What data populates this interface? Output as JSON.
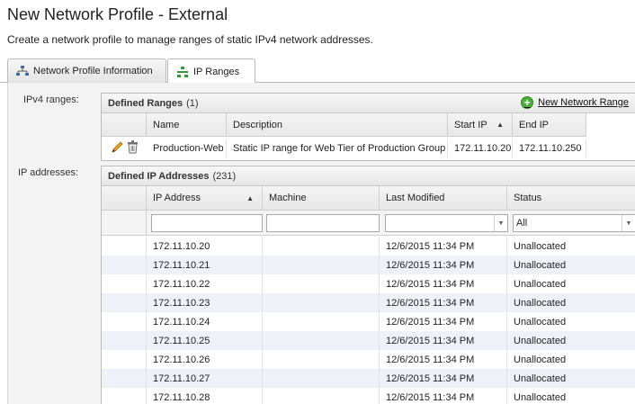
{
  "page": {
    "title": "New Network Profile - External",
    "subtitle": "Create a network profile to manage ranges of static IPv4 network addresses."
  },
  "tabs": [
    {
      "label": "Network Profile Information",
      "icon": "network-icon",
      "active": false
    },
    {
      "label": "IP Ranges",
      "icon": "ip-ranges-icon",
      "active": true
    }
  ],
  "ipv4": {
    "label": "IPv4 ranges:",
    "panel_title": "Defined Ranges",
    "count": "(1)",
    "new_range_label": "New Network Range",
    "columns": [
      "Name",
      "Description",
      "Start IP",
      "End IP"
    ],
    "rows": [
      {
        "name": "Production-Web",
        "description": "Static IP range for Web Tier of Production Group",
        "start_ip": "172.11.10.20",
        "end_ip": "172.11.10.250"
      }
    ]
  },
  "ip_addresses": {
    "label": "IP addresses:",
    "panel_title": "Defined IP Addresses",
    "count": "(231)",
    "columns": [
      "IP Address",
      "Machine",
      "Last Modified",
      "Status"
    ],
    "filters": {
      "ip": "",
      "machine": "",
      "last_modified": "",
      "status": "All"
    },
    "rows": [
      {
        "ip": "172.11.10.20",
        "machine": "",
        "modified": "12/6/2015 11:34 PM",
        "status": "Unallocated"
      },
      {
        "ip": "172.11.10.21",
        "machine": "",
        "modified": "12/6/2015 11:34 PM",
        "status": "Unallocated"
      },
      {
        "ip": "172.11.10.22",
        "machine": "",
        "modified": "12/6/2015 11:34 PM",
        "status": "Unallocated"
      },
      {
        "ip": "172.11.10.23",
        "machine": "",
        "modified": "12/6/2015 11:34 PM",
        "status": "Unallocated"
      },
      {
        "ip": "172.11.10.24",
        "machine": "",
        "modified": "12/6/2015 11:34 PM",
        "status": "Unallocated"
      },
      {
        "ip": "172.11.10.25",
        "machine": "",
        "modified": "12/6/2015 11:34 PM",
        "status": "Unallocated"
      },
      {
        "ip": "172.11.10.26",
        "machine": "",
        "modified": "12/6/2015 11:34 PM",
        "status": "Unallocated"
      },
      {
        "ip": "172.11.10.27",
        "machine": "",
        "modified": "12/6/2015 11:34 PM",
        "status": "Unallocated"
      },
      {
        "ip": "172.11.10.28",
        "machine": "",
        "modified": "12/6/2015 11:34 PM",
        "status": "Unallocated"
      }
    ]
  },
  "colors": {
    "row_alt": "#eef2f8",
    "border": "#bcbcbc",
    "plus_green": "#4caf3b",
    "pencil": "#e6a820"
  }
}
